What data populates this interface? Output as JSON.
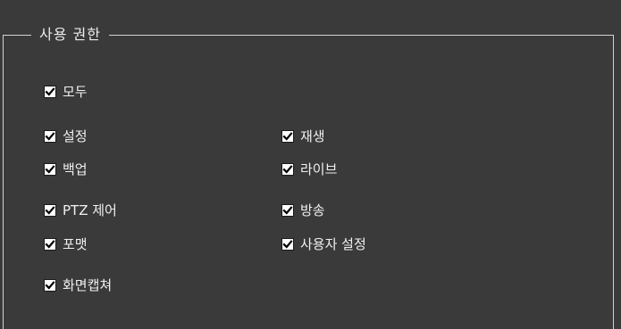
{
  "group": {
    "title": "사용 권한"
  },
  "options": [
    {
      "id": "all",
      "label": "모두",
      "checked": true
    },
    {
      "id": "settings",
      "label": "설정",
      "checked": true
    },
    {
      "id": "playback",
      "label": "재생",
      "checked": true
    },
    {
      "id": "backup",
      "label": "백업",
      "checked": true
    },
    {
      "id": "live",
      "label": "라이브",
      "checked": true
    },
    {
      "id": "ptz",
      "label": "PTZ 제어",
      "checked": true
    },
    {
      "id": "broadcast",
      "label": "방송",
      "checked": true
    },
    {
      "id": "format",
      "label": "포맷",
      "checked": true
    },
    {
      "id": "user-settings",
      "label": "사용자 설정",
      "checked": true
    },
    {
      "id": "screen-capture",
      "label": "화면캡쳐",
      "checked": true
    }
  ]
}
